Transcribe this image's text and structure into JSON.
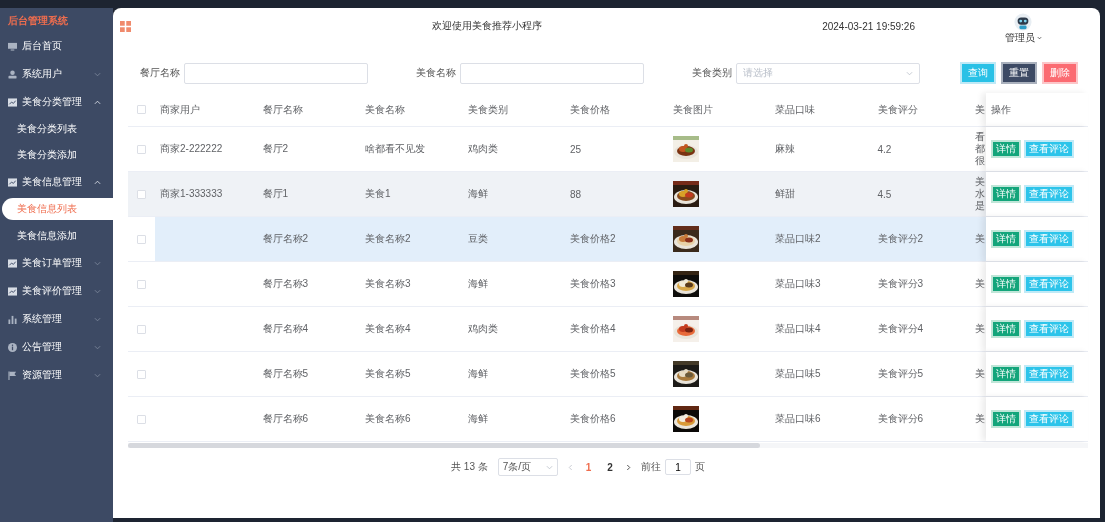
{
  "sidebar": {
    "title": "后台管理系统",
    "items": [
      {
        "label": "后台首页"
      },
      {
        "label": "系统用户",
        "expanded": false
      },
      {
        "label": "美食分类管理",
        "expanded": true,
        "children": [
          {
            "label": "美食分类列表",
            "selected": false
          },
          {
            "label": "美食分类添加",
            "selected": false
          }
        ]
      },
      {
        "label": "美食信息管理",
        "expanded": true,
        "children": [
          {
            "label": "美食信息列表",
            "selected": true
          },
          {
            "label": "美食信息添加",
            "selected": false
          }
        ]
      },
      {
        "label": "美食订单管理",
        "expanded": false
      },
      {
        "label": "美食评价管理",
        "expanded": false
      },
      {
        "label": "系统管理",
        "expanded": false
      },
      {
        "label": "公告管理",
        "expanded": false
      },
      {
        "label": "资源管理",
        "expanded": false
      }
    ]
  },
  "header": {
    "title": "欢迎使用美食推荐小程序",
    "datetime": "2024-03-21 19:59:26",
    "user": "管理员"
  },
  "search": {
    "fields": [
      {
        "label": "餐厅名称",
        "kind": "input"
      },
      {
        "label": "美食名称",
        "kind": "input"
      },
      {
        "label": "美食类别",
        "kind": "select",
        "placeholder": "请选择"
      }
    ],
    "buttons": [
      {
        "label": "查询",
        "kind": "search"
      },
      {
        "label": "重置",
        "kind": "reset"
      },
      {
        "label": "删除",
        "kind": "delete"
      }
    ]
  },
  "table": {
    "columns": [
      "商家用户",
      "餐厅名称",
      "美食名称",
      "美食类别",
      "美食价格",
      "美食图片",
      "菜品口味",
      "美食评分",
      "美",
      "操作"
    ],
    "header_checked": false,
    "rows": [
      {
        "checked": false,
        "shaded": false,
        "highlighted": false,
        "merchant": "商家2-222222",
        "restaurant": "餐厅2",
        "name": "啥都看不见发",
        "category": "鸡肉类",
        "price": "25",
        "image": {
          "kind": "picture"
        },
        "flavor": "麻辣",
        "rating": "4.2",
        "column_9": "看都很",
        "actions": [
          "详情",
          "查看评论"
        ]
      },
      {
        "checked": false,
        "shaded": true,
        "highlighted": false,
        "merchant": "商家1-333333",
        "restaurant": "餐厅1",
        "name": "美食1",
        "category": "海鲜",
        "price": "88",
        "image": {
          "kind": "picture"
        },
        "flavor": "鲜甜",
        "rating": "4.5",
        "column_9": "美水是",
        "actions": [
          "详情",
          "查看评论"
        ]
      },
      {
        "checked": false,
        "shaded": false,
        "highlighted": true,
        "restaurant": "餐厅名称2",
        "name": "美食名称2",
        "category": "豆类",
        "price": "美食价格2",
        "image": {
          "kind": "picture"
        },
        "flavor": "菜品口味2",
        "rating": "美食评分2",
        "column_9": "美",
        "actions": [
          "详情",
          "查看评论"
        ]
      },
      {
        "checked": false,
        "shaded": false,
        "highlighted": false,
        "restaurant": "餐厅名称3",
        "name": "美食名称3",
        "category": "海鲜",
        "price": "美食价格3",
        "image": {
          "kind": "picture"
        },
        "flavor": "菜品口味3",
        "rating": "美食评分3",
        "column_9": "美",
        "actions": [
          "详情",
          "查看评论"
        ]
      },
      {
        "checked": false,
        "shaded": false,
        "highlighted": false,
        "restaurant": "餐厅名称4",
        "name": "美食名称4",
        "category": "鸡肉类",
        "price": "美食价格4",
        "image": {
          "kind": "picture"
        },
        "flavor": "菜品口味4",
        "rating": "美食评分4",
        "column_9": "美",
        "actions": [
          "详情",
          "查看评论"
        ]
      },
      {
        "checked": false,
        "shaded": false,
        "highlighted": false,
        "restaurant": "餐厅名称5",
        "name": "美食名称5",
        "category": "海鲜",
        "price": "美食价格5",
        "image": {
          "kind": "picture"
        },
        "flavor": "菜品口味5",
        "rating": "美食评分5",
        "column_9": "美",
        "actions": [
          "详情",
          "查看评论"
        ]
      },
      {
        "checked": false,
        "shaded": false,
        "highlighted": false,
        "restaurant": "餐厅名称6",
        "name": "美食名称6",
        "category": "海鲜",
        "price": "美食价格6",
        "image": {
          "kind": "picture"
        },
        "flavor": "菜品口味6",
        "rating": "美食评分6",
        "column_9": "美",
        "actions": [
          "详情",
          "查看评论"
        ]
      }
    ]
  },
  "pagination": {
    "total": "共 13 条",
    "page_size": "7条/页",
    "pages": [
      {
        "label": "1",
        "selected": true
      },
      {
        "label": "2",
        "selected": false
      }
    ],
    "goto_label": "前往",
    "goto_value": "1",
    "goto_suffix": "页"
  }
}
